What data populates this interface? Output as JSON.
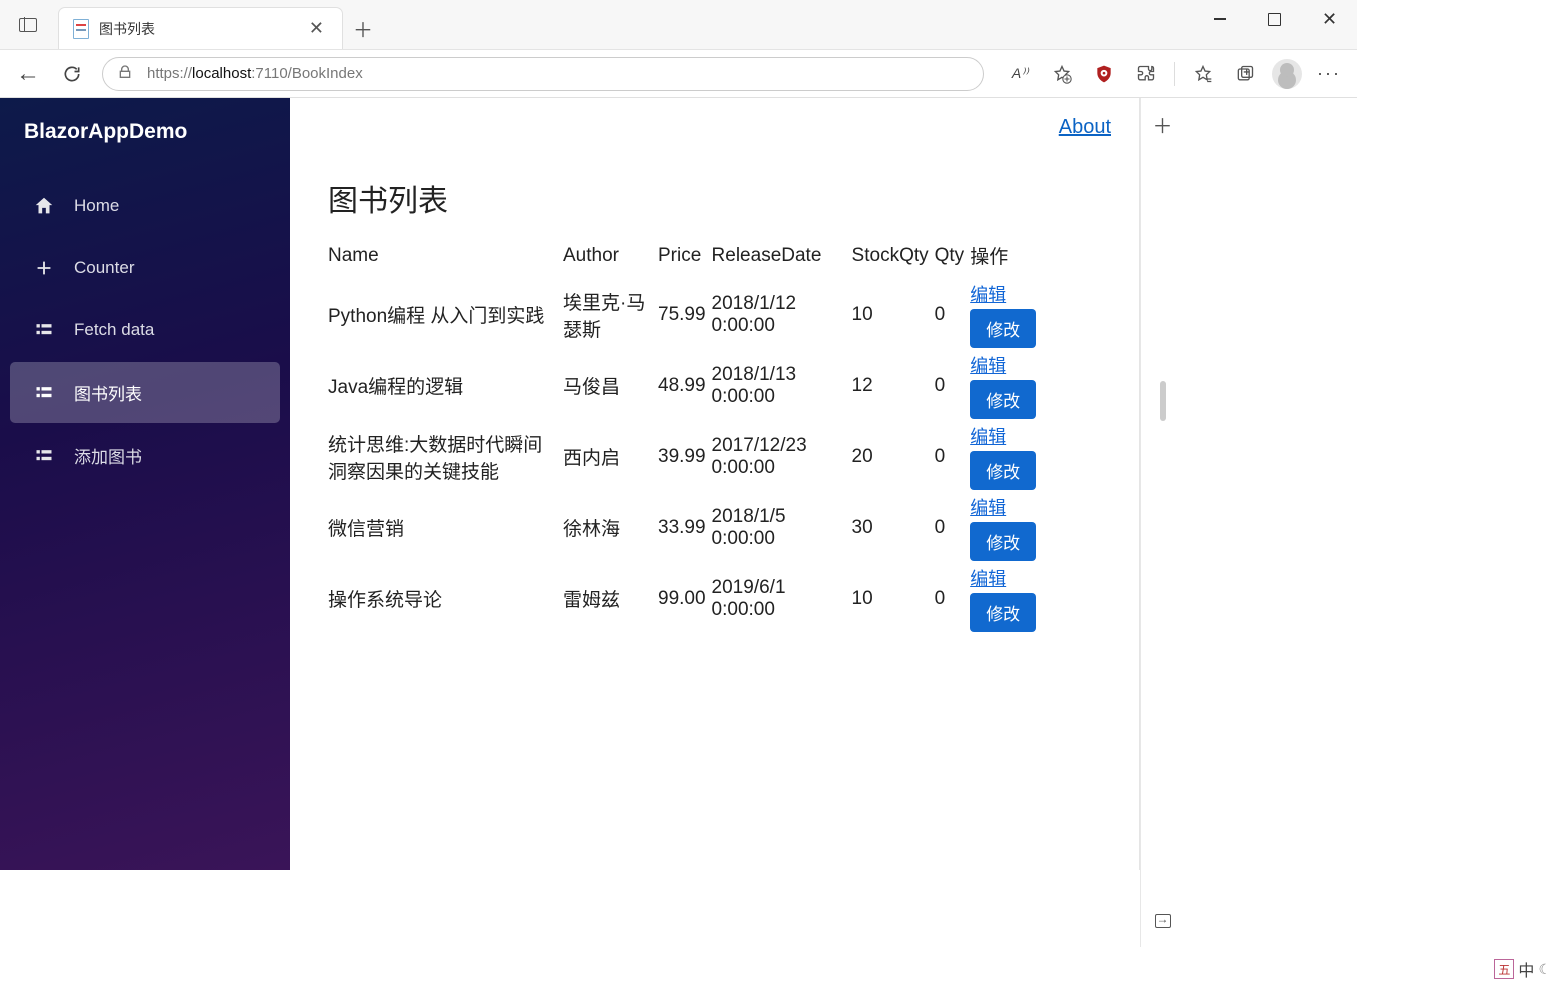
{
  "browser": {
    "tab_title": "图书列表",
    "url_prefix": "https://",
    "url_host": "localhost",
    "url_rest": ":7110/BookIndex"
  },
  "app": {
    "brand": "BlazorAppDemo",
    "about": "About",
    "nav": [
      {
        "label": "Home"
      },
      {
        "label": "Counter"
      },
      {
        "label": "Fetch data"
      },
      {
        "label": "图书列表"
      },
      {
        "label": "添加图书"
      }
    ],
    "active_nav_index": 3,
    "page_title": "图书列表",
    "columns": {
      "name": "Name",
      "author": "Author",
      "price": "Price",
      "release": "ReleaseDate",
      "stock": "StockQty",
      "qty": "Qty",
      "ops": "操作"
    },
    "action_labels": {
      "edit": "编辑",
      "modify": "修改"
    },
    "rows": [
      {
        "name": "Python编程 从入门到实践",
        "author": "埃里克·马瑟斯",
        "price": "75.99",
        "release": "2018/1/12 0:00:00",
        "stock": "10",
        "qty": "0"
      },
      {
        "name": "Java编程的逻辑",
        "author": "马俊昌",
        "price": "48.99",
        "release": "2018/1/13 0:00:00",
        "stock": "12",
        "qty": "0"
      },
      {
        "name": "统计思维:大数据时代瞬间洞察因果的关键技能",
        "author": "西内启",
        "price": "39.99",
        "release": "2017/12/23 0:00:00",
        "stock": "20",
        "qty": "0"
      },
      {
        "name": "微信营销",
        "author": "徐林海",
        "price": "33.99",
        "release": "2018/1/5 0:00:00",
        "stock": "30",
        "qty": "0"
      },
      {
        "name": "操作系统导论",
        "author": "雷姆兹",
        "price": "99.00",
        "release": "2019/6/1 0:00:00",
        "stock": "10",
        "qty": "0"
      }
    ]
  },
  "ime": {
    "box": "五",
    "lang": "中"
  }
}
